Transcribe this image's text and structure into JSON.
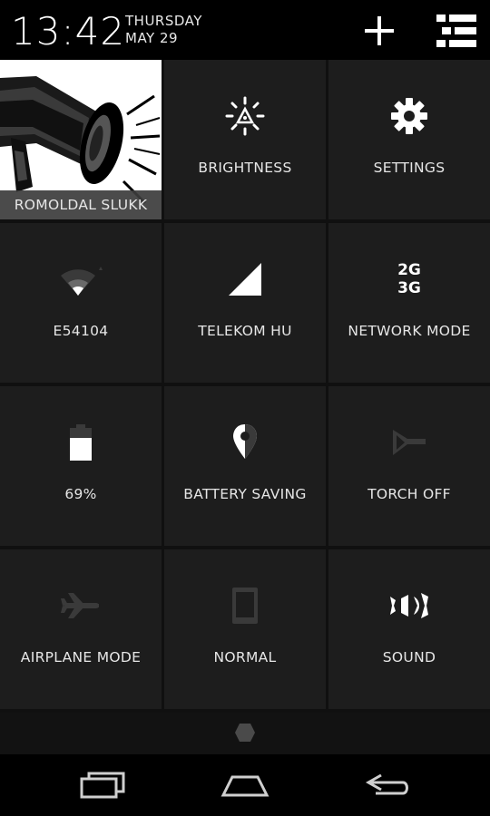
{
  "header": {
    "time": "13:42",
    "day": "THURSDAY",
    "date": "MAY 29",
    "add_icon": "plus-icon",
    "list_icon": "list-icon"
  },
  "tiles": {
    "profile": {
      "name": "ROMOLDAL SLUKK",
      "icon": "megaphone-icon"
    },
    "brightness": {
      "label": "BRIGHTNESS",
      "icon": "brightness-icon"
    },
    "settings": {
      "label": "SETTINGS",
      "icon": "gear-icon"
    },
    "wifi": {
      "label": "E54104",
      "icon": "wifi-icon"
    },
    "mobile": {
      "label": "TELEKOM HU",
      "icon": "signal-icon"
    },
    "network_mode": {
      "label": "NETWORK MODE",
      "line1": "2G",
      "line2": "3G",
      "icon": "network-mode-icon"
    },
    "battery": {
      "label": "69%",
      "icon": "battery-icon",
      "level": 0.69
    },
    "battery_saving": {
      "label": "BATTERY SAVING",
      "icon": "location-icon"
    },
    "torch": {
      "label": "TORCH OFF",
      "icon": "torch-icon"
    },
    "airplane": {
      "label": "AIRPLANE MODE",
      "icon": "airplane-icon"
    },
    "ringer": {
      "label": "NORMAL",
      "icon": "phone-icon"
    },
    "sound": {
      "label": "SOUND",
      "icon": "speaker-icon"
    }
  },
  "navigation": {
    "recents_icon": "recents-icon",
    "home_icon": "home-icon",
    "back_icon": "back-icon"
  },
  "colors": {
    "background": "#000000",
    "tile": "#1d1d1d",
    "text": "#e6e6e6",
    "dim_icon": "#3a3a3a"
  }
}
